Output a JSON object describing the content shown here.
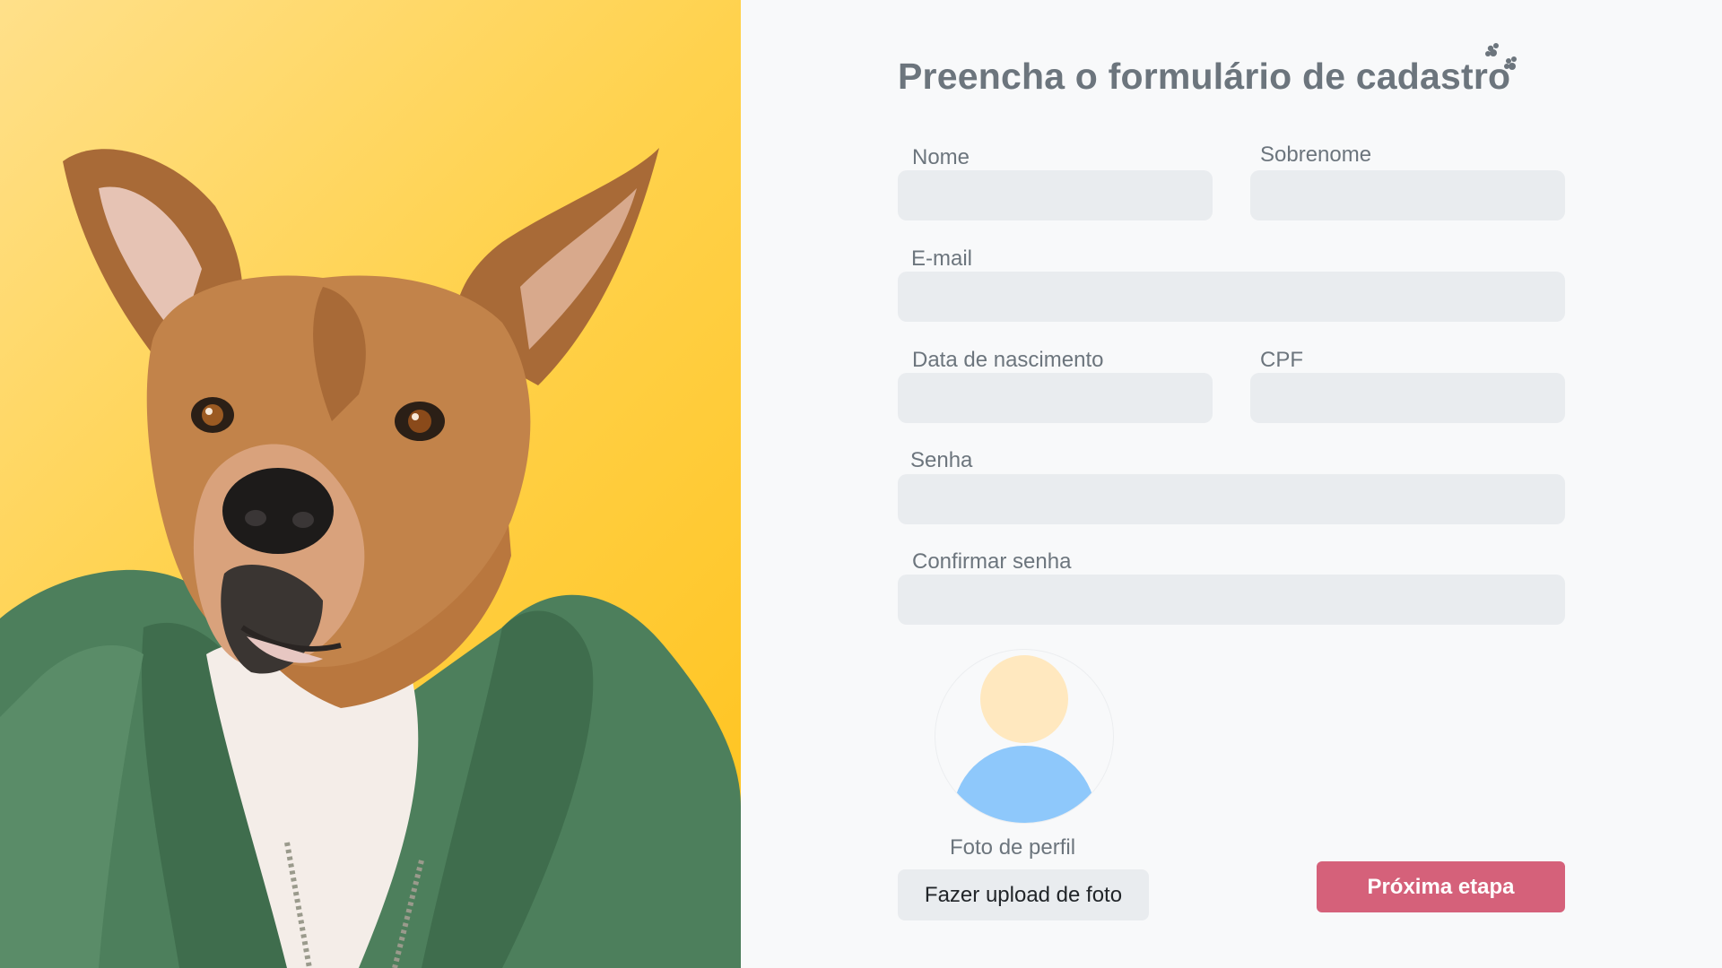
{
  "hero": {
    "image": "dog-in-green-jacket-photo",
    "background_colors": [
      "#ffe08a",
      "#ffc21a"
    ]
  },
  "form": {
    "title": "Preencha o formulário de cadastro",
    "title_icon": "paw-icon",
    "fields": {
      "first_name": {
        "label": "Nome",
        "value": "",
        "placeholder": ""
      },
      "last_name": {
        "label": "Sobrenome",
        "value": "",
        "placeholder": ""
      },
      "email": {
        "label": "E-mail",
        "value": "",
        "placeholder": ""
      },
      "birth_date": {
        "label": "Data de nascimento",
        "value": "",
        "placeholder": ""
      },
      "cpf": {
        "label": "CPF",
        "value": "",
        "placeholder": ""
      },
      "password": {
        "label": "Senha",
        "value": "",
        "placeholder": ""
      },
      "confirm_password": {
        "label": "Confirmar senha",
        "value": "",
        "placeholder": ""
      }
    },
    "profile_photo": {
      "caption": "Foto de perfil",
      "upload_label": "Fazer upload de foto"
    },
    "next_label": "Próxima etapa"
  },
  "colors": {
    "accent": "#d5617a",
    "input_bg": "#e9ecef",
    "label": "#6c757d",
    "avatar_head": "#ffe8bf",
    "avatar_body": "#8ec8fb"
  }
}
